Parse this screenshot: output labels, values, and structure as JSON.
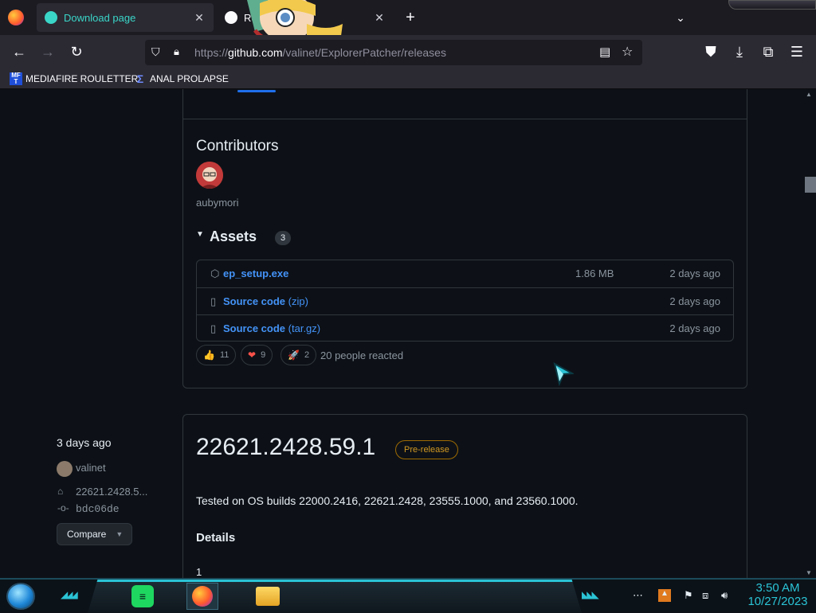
{
  "browser": {
    "tabs": [
      {
        "label": "Download page",
        "active": true
      },
      {
        "label": "Re...erPatch",
        "active": false
      }
    ],
    "url": {
      "prefix": "https://",
      "host": "github.com",
      "path": "/valinet/ExplorerPatcher/releases"
    },
    "bookmarks": [
      {
        "label": "MEDIAFIRE ROULETTER",
        "icon": "mft-icon",
        "icon_text": "MF T"
      },
      {
        "label": "ANAL PROLAPSE",
        "icon": "sigma-icon",
        "icon_text": "Σ"
      }
    ]
  },
  "release1": {
    "contributors_title": "Contributors",
    "contributor": "aubymori",
    "assets_title": "Assets",
    "assets_count": "3",
    "assets": [
      {
        "icon": "package-icon",
        "name": "ep_setup.exe",
        "ext": "",
        "size": "1.86 MB",
        "date": "2 days ago"
      },
      {
        "icon": "file-zip-icon",
        "name": "Source code",
        "ext": "(zip)",
        "size": "",
        "date": "2 days ago"
      },
      {
        "icon": "file-zip-icon",
        "name": "Source code",
        "ext": "(tar.gz)",
        "size": "",
        "date": "2 days ago"
      }
    ],
    "reactions": [
      {
        "emoji": "👍",
        "count": "11"
      },
      {
        "emoji": "❤",
        "count": "9"
      },
      {
        "emoji": "🚀",
        "count": "2"
      }
    ],
    "reacted_text": "20 people reacted"
  },
  "release2": {
    "date": "3 days ago",
    "author": "valinet",
    "tag": "22621.2428.5...",
    "commit": "bdc06de",
    "compare_label": "Compare",
    "title": "22621.2428.59.1",
    "badge": "Pre-release",
    "body": "Tested on OS builds 22000.2416, 22621.2428, 23555.1000, and 23560.1000.",
    "details_heading": "Details",
    "details_first": "1"
  },
  "taskbar": {
    "time": "3:50 AM",
    "date": "10/27/2023"
  },
  "colors": {
    "page_bg": "#0d1117",
    "link": "#4493f8",
    "prerelease": "#d29922",
    "taskbar_accent": "#2bc4d6"
  }
}
